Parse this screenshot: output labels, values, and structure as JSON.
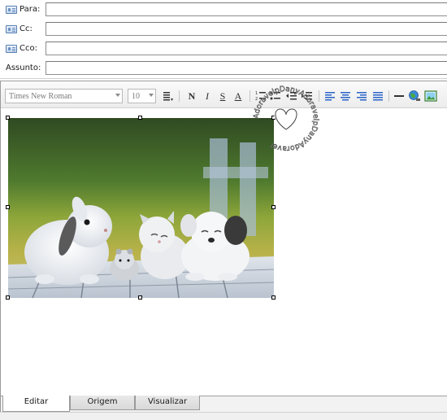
{
  "header": {
    "fields": [
      {
        "label": "Para:",
        "value": "",
        "icon": "address-book-icon"
      },
      {
        "label": "Cc:",
        "value": "",
        "icon": "address-book-icon"
      },
      {
        "label": "Cco:",
        "value": "",
        "icon": "address-book-icon"
      },
      {
        "label": "Assunto:",
        "value": ""
      }
    ]
  },
  "toolbar": {
    "font_family": "Times New Roman",
    "font_size": "10",
    "bold_label": "N",
    "italic_label": "I",
    "strike_label": "S",
    "color_label": "A",
    "accent_color": "#2a64c8"
  },
  "content": {
    "image_description_icon": "animals-photo",
    "watermark_text": "AdoravelpDanyAdoravelpDanyAdoravel"
  },
  "tabs": [
    {
      "label": "Editar",
      "active": true
    },
    {
      "label": "Origem",
      "active": false
    },
    {
      "label": "Visualizar",
      "active": false
    }
  ]
}
